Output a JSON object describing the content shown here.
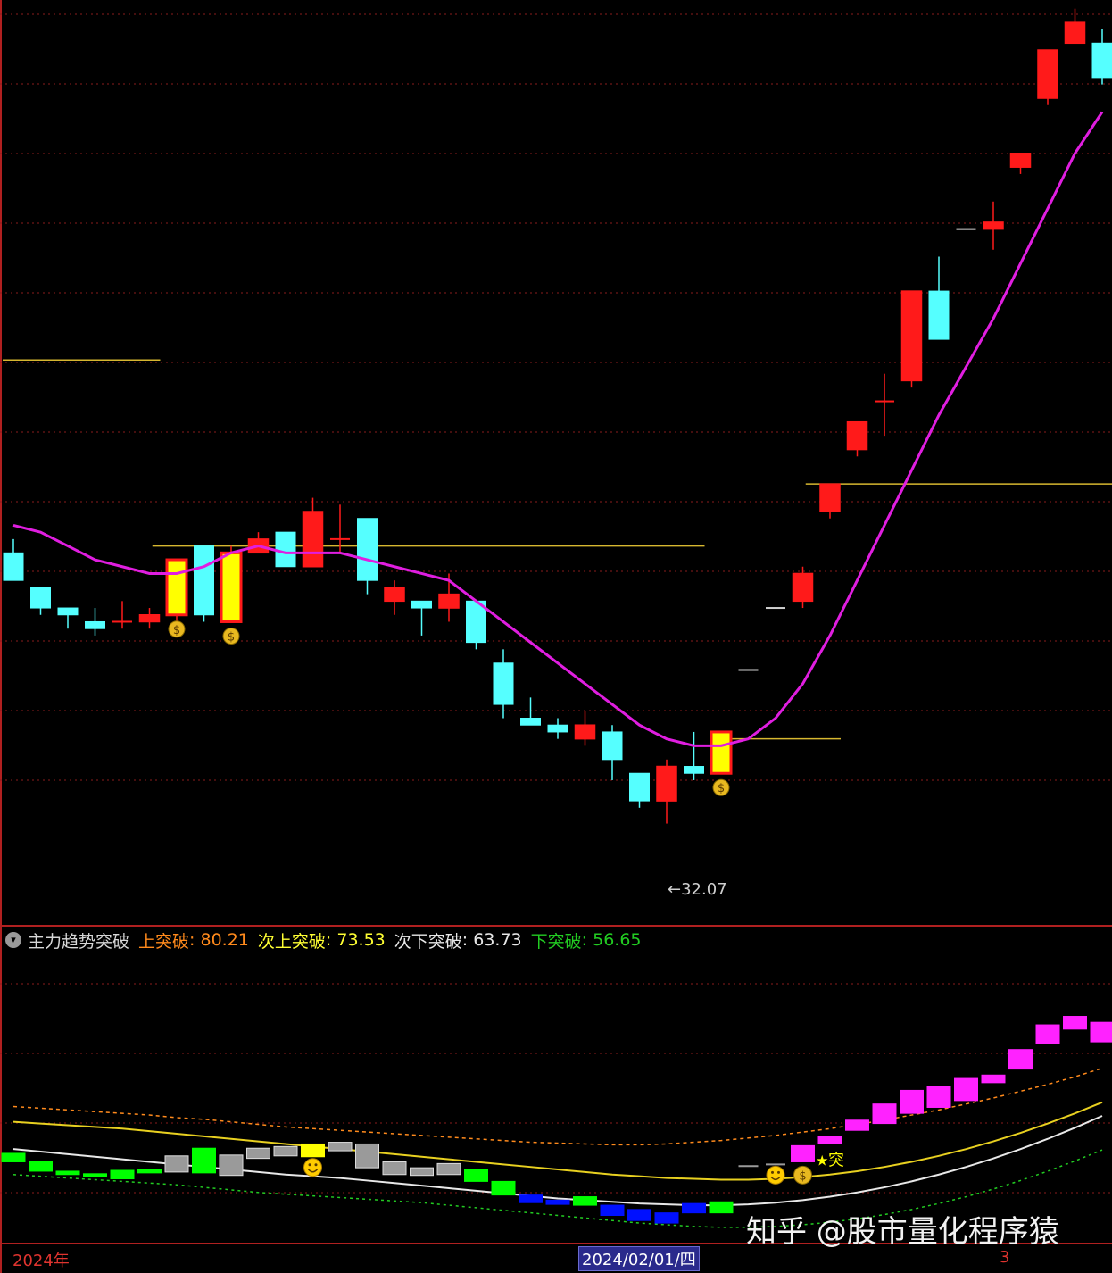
{
  "indicator": {
    "name": "主力趋势突破",
    "icon": "chevron-down-icon",
    "labels": [
      {
        "key": "up1",
        "label": "上突破",
        "value": "80.21",
        "color": "#ff8a1c"
      },
      {
        "key": "up2",
        "label": "次上突破",
        "value": "73.53",
        "color": "#ffff33"
      },
      {
        "key": "dn2",
        "label": "次下突破",
        "value": "63.73",
        "color": "#e8e8e8"
      },
      {
        "key": "dn1",
        "label": "下突破",
        "value": "56.65",
        "color": "#22cc22"
      }
    ]
  },
  "x_axis": {
    "labels": [
      "2024年",
      "2024/02/01/四",
      "3"
    ]
  },
  "annotations": {
    "low_marker": "←32.07"
  },
  "watermark": "知乎 @股市量化程序猿",
  "colors": {
    "bull": "#ff1a1a",
    "bear": "#55ffff",
    "ma": "#e01ee0",
    "signal_fill": "#ffff00",
    "level_line": "#d6b730",
    "grid": "#8a1d1d"
  },
  "chart_data": [
    {
      "type": "candlestick",
      "title": "",
      "ylim": [
        30.6,
        44.0
      ],
      "low_label": 32.07,
      "candles": [
        {
          "o": 36.0,
          "h": 36.2,
          "l": 35.6,
          "c": 35.6
        },
        {
          "o": 35.5,
          "h": 35.5,
          "l": 35.1,
          "c": 35.2
        },
        {
          "o": 35.2,
          "h": 35.2,
          "l": 34.9,
          "c": 35.1
        },
        {
          "o": 35.0,
          "h": 35.2,
          "l": 34.8,
          "c": 34.9
        },
        {
          "o": 35.0,
          "h": 35.3,
          "l": 34.9,
          "c": 35.0
        },
        {
          "o": 35.0,
          "h": 35.2,
          "l": 34.9,
          "c": 35.1
        },
        {
          "o": 35.1,
          "h": 35.9,
          "l": 35.0,
          "c": 35.9,
          "sig": true
        },
        {
          "o": 36.1,
          "h": 36.1,
          "l": 35.0,
          "c": 35.1
        },
        {
          "o": 35.0,
          "h": 36.1,
          "l": 35.0,
          "c": 36.0,
          "sig": true
        },
        {
          "o": 36.0,
          "h": 36.3,
          "l": 36.0,
          "c": 36.2
        },
        {
          "o": 36.3,
          "h": 36.3,
          "l": 35.8,
          "c": 35.8
        },
        {
          "o": 35.8,
          "h": 36.8,
          "l": 35.8,
          "c": 36.6
        },
        {
          "o": 36.2,
          "h": 36.7,
          "l": 36.0,
          "c": 36.2
        },
        {
          "o": 36.5,
          "h": 36.5,
          "l": 35.4,
          "c": 35.6
        },
        {
          "o": 35.3,
          "h": 35.6,
          "l": 35.1,
          "c": 35.5
        },
        {
          "o": 35.3,
          "h": 35.3,
          "l": 34.8,
          "c": 35.2
        },
        {
          "o": 35.2,
          "h": 35.7,
          "l": 35.0,
          "c": 35.4
        },
        {
          "o": 35.3,
          "h": 35.3,
          "l": 34.6,
          "c": 34.7
        },
        {
          "o": 34.4,
          "h": 34.6,
          "l": 33.6,
          "c": 33.8
        },
        {
          "o": 33.6,
          "h": 33.9,
          "l": 33.5,
          "c": 33.5
        },
        {
          "o": 33.5,
          "h": 33.6,
          "l": 33.3,
          "c": 33.4
        },
        {
          "o": 33.3,
          "h": 33.7,
          "l": 33.2,
          "c": 33.5
        },
        {
          "o": 33.4,
          "h": 33.5,
          "l": 32.7,
          "c": 33.0
        },
        {
          "o": 32.8,
          "h": 32.8,
          "l": 32.3,
          "c": 32.4
        },
        {
          "o": 32.4,
          "h": 33.0,
          "l": 32.07,
          "c": 32.9
        },
        {
          "o": 32.9,
          "h": 33.4,
          "l": 32.7,
          "c": 32.8
        },
        {
          "o": 32.8,
          "h": 33.4,
          "l": 32.8,
          "c": 33.4,
          "sig": true
        },
        {
          "o": 34.3,
          "h": 34.3,
          "l": 34.3,
          "c": 34.3
        },
        {
          "o": 35.2,
          "h": 35.2,
          "l": 35.2,
          "c": 35.2
        },
        {
          "o": 35.3,
          "h": 35.8,
          "l": 35.2,
          "c": 35.7
        },
        {
          "o": 36.6,
          "h": 37.0,
          "l": 36.5,
          "c": 37.0
        },
        {
          "o": 37.5,
          "h": 37.9,
          "l": 37.4,
          "c": 37.9
        },
        {
          "o": 38.2,
          "h": 38.6,
          "l": 37.7,
          "c": 38.2
        },
        {
          "o": 38.5,
          "h": 39.8,
          "l": 38.4,
          "c": 39.8
        },
        {
          "o": 39.8,
          "h": 40.3,
          "l": 39.4,
          "c": 39.1
        },
        {
          "o": 40.7,
          "h": 40.7,
          "l": 40.7,
          "c": 40.7
        },
        {
          "o": 40.7,
          "h": 41.1,
          "l": 40.4,
          "c": 40.8
        },
        {
          "o": 41.6,
          "h": 41.8,
          "l": 41.5,
          "c": 41.8
        },
        {
          "o": 42.6,
          "h": 43.3,
          "l": 42.5,
          "c": 43.3
        },
        {
          "o": 43.4,
          "h": 43.9,
          "l": 43.4,
          "c": 43.7
        },
        {
          "o": 43.4,
          "h": 43.6,
          "l": 42.8,
          "c": 42.9
        }
      ],
      "ma": [
        36.4,
        36.3,
        36.1,
        35.9,
        35.8,
        35.7,
        35.7,
        35.8,
        36.0,
        36.1,
        36.0,
        36.0,
        36.0,
        35.9,
        35.8,
        35.7,
        35.6,
        35.3,
        35.0,
        34.7,
        34.4,
        34.1,
        33.8,
        33.5,
        33.3,
        33.2,
        33.2,
        33.3,
        33.6,
        34.1,
        34.8,
        35.6,
        36.4,
        37.2,
        38.0,
        38.7,
        39.4,
        40.2,
        41.0,
        41.8,
        42.4
      ],
      "levels": [
        {
          "value": 38.8,
          "from": 0,
          "to": 5
        },
        {
          "value": 36.1,
          "from": 5.5,
          "to": 25
        },
        {
          "value": 33.3,
          "from": 26,
          "to": 30
        },
        {
          "value": 37.0,
          "from": 29.5,
          "to": 40.5
        }
      ]
    },
    {
      "type": "indicator",
      "ylim": [
        50,
        84
      ],
      "series": [
        {
          "name": "上突破",
          "values": [
            66.0,
            65.8,
            65.6,
            65.4,
            65.2,
            65.0,
            64.7,
            64.5,
            64.2,
            63.9,
            63.6,
            63.4,
            63.2,
            63.0,
            62.8,
            62.6,
            62.4,
            62.2,
            62.0,
            61.8,
            61.7,
            61.6,
            61.5,
            61.5,
            61.6,
            61.8,
            62.0,
            62.3,
            62.6,
            63.0,
            63.4,
            63.9,
            64.4,
            65.0,
            65.6,
            66.3,
            67.0,
            67.8,
            68.6,
            69.5,
            70.5
          ]
        },
        {
          "name": "次上突破",
          "values": [
            64.2,
            64.0,
            63.8,
            63.6,
            63.4,
            63.1,
            62.8,
            62.5,
            62.2,
            61.9,
            61.6,
            61.3,
            61.0,
            60.7,
            60.4,
            60.1,
            59.8,
            59.5,
            59.2,
            58.9,
            58.6,
            58.3,
            58.0,
            57.8,
            57.6,
            57.5,
            57.4,
            57.4,
            57.5,
            57.7,
            58.0,
            58.4,
            58.9,
            59.5,
            60.2,
            61.0,
            61.9,
            62.9,
            64.0,
            65.2,
            66.5
          ]
        },
        {
          "name": "次下突破",
          "values": [
            61.0,
            60.7,
            60.4,
            60.1,
            59.8,
            59.5,
            59.2,
            58.9,
            58.6,
            58.3,
            58.0,
            57.8,
            57.6,
            57.3,
            57.0,
            56.7,
            56.4,
            56.1,
            55.8,
            55.5,
            55.2,
            55.0,
            54.8,
            54.6,
            54.5,
            54.4,
            54.4,
            54.5,
            54.7,
            55.0,
            55.4,
            55.9,
            56.5,
            57.2,
            58.0,
            58.9,
            59.9,
            61.0,
            62.2,
            63.5,
            64.9
          ]
        },
        {
          "name": "下突破",
          "values": [
            58.0,
            57.8,
            57.6,
            57.4,
            57.2,
            57.0,
            56.8,
            56.5,
            56.2,
            55.9,
            55.7,
            55.5,
            55.3,
            55.1,
            54.9,
            54.7,
            54.4,
            54.1,
            53.8,
            53.5,
            53.2,
            52.9,
            52.6,
            52.3,
            52.1,
            51.9,
            51.8,
            51.8,
            51.9,
            52.1,
            52.4,
            52.8,
            53.3,
            53.9,
            54.6,
            55.4,
            56.3,
            57.3,
            58.4,
            59.6,
            60.9
          ]
        }
      ],
      "blocks": [
        {
          "o": 60.5,
          "c": 59.5,
          "col": "lime"
        },
        {
          "o": 59.5,
          "c": 58.4,
          "col": "lime"
        },
        {
          "o": 58.4,
          "c": 58.0,
          "col": "lime"
        },
        {
          "o": 58.1,
          "c": 57.8,
          "col": "lime"
        },
        {
          "o": 58.5,
          "c": 57.5,
          "col": "lime"
        },
        {
          "o": 58.6,
          "c": 58.2,
          "col": "lime"
        },
        {
          "o": 60.2,
          "c": 58.3,
          "col": "gray"
        },
        {
          "o": 61.1,
          "c": 58.2,
          "col": "lime"
        },
        {
          "o": 60.3,
          "c": 57.9,
          "col": "gray"
        },
        {
          "o": 61.1,
          "c": 59.9,
          "col": "gray"
        },
        {
          "o": 61.3,
          "c": 60.2,
          "col": "gray"
        },
        {
          "o": 61.6,
          "c": 60.1,
          "col": "yellow"
        },
        {
          "o": 61.8,
          "c": 60.8,
          "col": "gray"
        },
        {
          "o": 61.6,
          "c": 58.8,
          "col": "gray"
        },
        {
          "o": 59.5,
          "c": 58.0,
          "col": "gray"
        },
        {
          "o": 58.8,
          "c": 57.9,
          "col": "gray"
        },
        {
          "o": 59.3,
          "c": 58.0,
          "col": "gray"
        },
        {
          "o": 58.6,
          "c": 57.2,
          "col": "lime"
        },
        {
          "o": 57.2,
          "c": 55.6,
          "col": "lime"
        },
        {
          "o": 55.6,
          "c": 54.7,
          "col": "blue"
        },
        {
          "o": 55.0,
          "c": 54.5,
          "col": "blue"
        },
        {
          "o": 55.4,
          "c": 54.4,
          "col": "lime"
        },
        {
          "o": 54.4,
          "c": 53.2,
          "col": "blue"
        },
        {
          "o": 53.9,
          "c": 52.6,
          "col": "blue"
        },
        {
          "o": 53.5,
          "c": 52.3,
          "col": "blue"
        },
        {
          "o": 54.6,
          "c": 53.5,
          "col": "blue"
        },
        {
          "o": 54.8,
          "c": 53.5,
          "col": "lime"
        },
        {
          "o": 59.0,
          "c": 59.0,
          "col": "gray"
        },
        {
          "o": 59.2,
          "c": 59.2,
          "col": "gray"
        },
        {
          "o": 61.4,
          "c": 59.5,
          "col": "magenta"
        },
        {
          "o": 62.5,
          "c": 61.6,
          "col": "magenta"
        },
        {
          "o": 64.4,
          "c": 63.2,
          "col": "magenta"
        },
        {
          "o": 66.3,
          "c": 64.0,
          "col": "magenta"
        },
        {
          "o": 67.9,
          "c": 65.2,
          "col": "magenta"
        },
        {
          "o": 68.4,
          "c": 65.9,
          "col": "magenta"
        },
        {
          "o": 69.3,
          "c": 66.7,
          "col": "magenta"
        },
        {
          "o": 69.7,
          "c": 68.8,
          "col": "magenta"
        },
        {
          "o": 72.7,
          "c": 70.4,
          "col": "magenta"
        },
        {
          "o": 75.6,
          "c": 73.4,
          "col": "magenta"
        },
        {
          "o": 76.6,
          "c": 75.1,
          "col": "magenta"
        },
        {
          "o": 75.9,
          "c": 73.6,
          "col": "magenta"
        }
      ],
      "smiles": [
        11,
        28
      ],
      "money_signals": [
        29
      ],
      "breakout_mark": {
        "index": 30,
        "text": "突"
      }
    }
  ]
}
